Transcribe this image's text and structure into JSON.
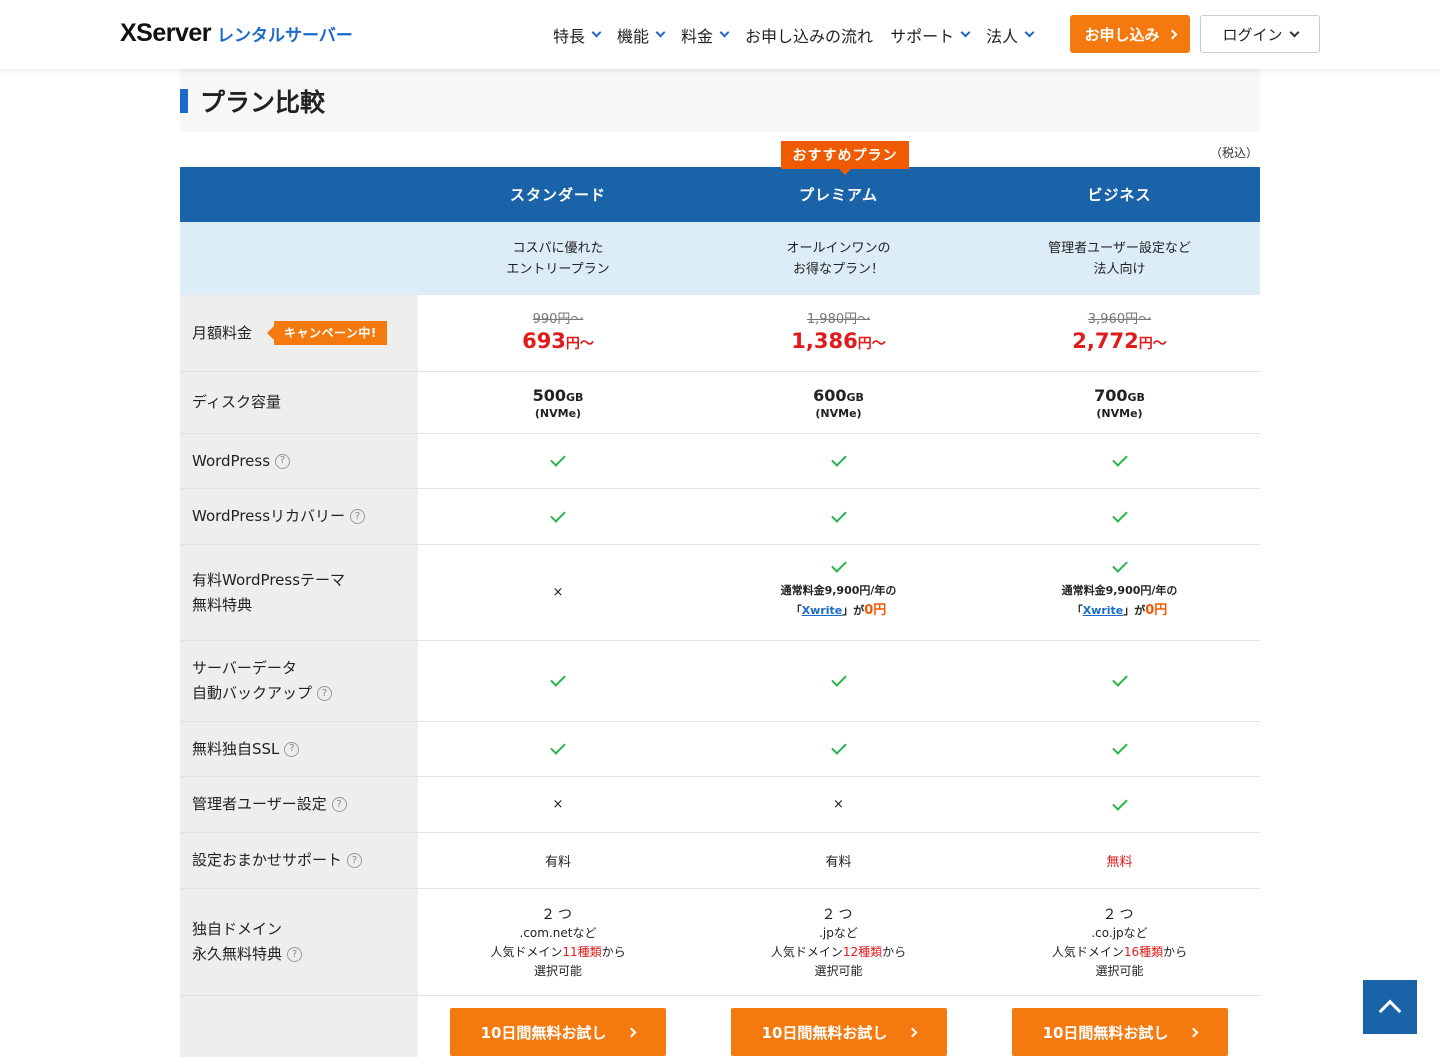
{
  "header": {
    "logo_main": "XServer",
    "logo_sub": "レンタルサーバー",
    "nav": [
      {
        "label": "特長",
        "has_dropdown": true
      },
      {
        "label": "機能",
        "has_dropdown": true
      },
      {
        "label": "料金",
        "has_dropdown": true
      },
      {
        "label": "お申し込みの流れ",
        "has_dropdown": false
      },
      {
        "label": "サポート",
        "has_dropdown": true
      },
      {
        "label": "法人",
        "has_dropdown": true
      }
    ],
    "apply_label": "お申し込み",
    "login_label": "ログイン"
  },
  "section": {
    "title": "プラン比較",
    "tax_note": "（税込）",
    "recommend_badge": "おすすめプラン"
  },
  "plans": [
    {
      "name": "スタンダード",
      "desc_1": "コスパに優れた",
      "desc_2": "エントリープラン"
    },
    {
      "name": "プレミアム",
      "desc_1": "オールインワンの",
      "desc_2": "お得なプラン！"
    },
    {
      "name": "ビジネス",
      "desc_1": "管理者ユーザー設定など",
      "desc_2": "法人向け"
    }
  ],
  "rows": {
    "price": {
      "label": "月額料金",
      "campaign": "キャンペーン中!",
      "values": [
        {
          "old": "990円〜",
          "amount": "693",
          "unit": "円〜"
        },
        {
          "old": "1,980円〜",
          "amount": "1,386",
          "unit": "円〜"
        },
        {
          "old": "3,960円〜",
          "amount": "2,772",
          "unit": "円〜"
        }
      ]
    },
    "disk": {
      "label": "ディスク容量",
      "values": [
        {
          "amount": "500",
          "unit": "GB",
          "sub": "(NVMe)"
        },
        {
          "amount": "600",
          "unit": "GB",
          "sub": "(NVMe)"
        },
        {
          "amount": "700",
          "unit": "GB",
          "sub": "(NVMe)"
        }
      ]
    },
    "wordpress": {
      "label": "WordPress",
      "help": "?"
    },
    "wp_recovery": {
      "label": "WordPressリカバリー",
      "help": "?"
    },
    "theme": {
      "label_1": "有料WordPressテーマ",
      "label_2": "無料特典",
      "none": "×",
      "note": "通常料金9,900円/年の",
      "bracket_open": "「",
      "link": "Xwrite",
      "bracket_close": "」が",
      "free": "0円"
    },
    "backup": {
      "label_1": "サーバーデータ",
      "label_2": "自動バックアップ",
      "help": "?"
    },
    "ssl": {
      "label": "無料独自SSL",
      "help": "?"
    },
    "admin": {
      "label": "管理者ユーザー設定",
      "help": "?",
      "none": "×"
    },
    "support": {
      "label": "設定おまかせサポート",
      "help": "?",
      "values": [
        "有料",
        "有料",
        "無料"
      ]
    },
    "domain": {
      "label_1": "独自ドメイン",
      "label_2": "永久無料特典",
      "help": "?",
      "values": [
        {
          "count": "２つ",
          "ex": ".com.netなど",
          "pre": "人気ドメイン",
          "num": "11種類",
          "post": "から",
          "last": "選択可能"
        },
        {
          "count": "２つ",
          "ex": ".jpなど",
          "pre": "人気ドメイン",
          "num": "12種類",
          "post": "から",
          "last": "選択可能"
        },
        {
          "count": "２つ",
          "ex": ".co.jpなど",
          "pre": "人気ドメイン",
          "num": "16種類",
          "post": "から",
          "last": "選択可能"
        }
      ]
    }
  },
  "cta_label": "10日間無料お試し",
  "colors": {
    "brand_blue": "#1a63a8",
    "accent_orange": "#f47a0f",
    "price_red": "#e01b1b",
    "check_green": "#2ab34a"
  }
}
